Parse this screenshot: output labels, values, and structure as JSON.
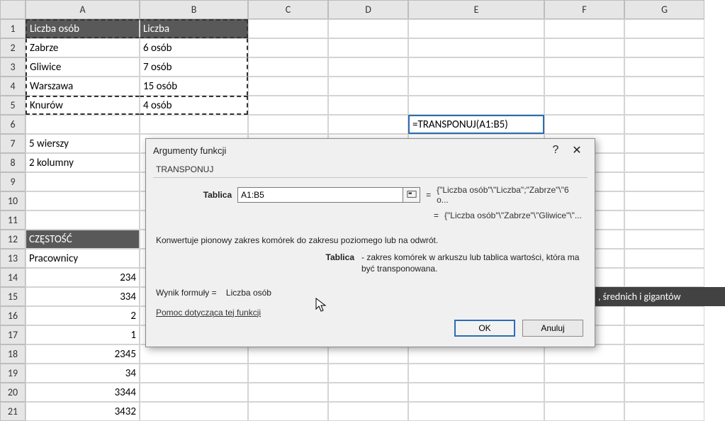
{
  "columns": [
    "A",
    "B",
    "C",
    "D",
    "E",
    "F",
    "G"
  ],
  "rows": [
    "1",
    "2",
    "3",
    "4",
    "5",
    "6",
    "7",
    "8",
    "9",
    "10",
    "11",
    "12",
    "13",
    "14",
    "15",
    "16",
    "17",
    "18",
    "19",
    "20",
    "21"
  ],
  "grid": {
    "A1": "Liczba osób",
    "B1": "Liczba",
    "A2": "Zabrze",
    "B2": "6 osób",
    "A3": "Gliwice",
    "B3": "7 osób",
    "A4": "Warszawa",
    "B4": "15 osób",
    "A5": "Knurów",
    "B5": "4 osób",
    "E6": "=TRANSPONUJ(A1:B5)",
    "A7": "5 wierszy",
    "A8": "2 kolumny",
    "A12": "CZĘSTOŚĆ",
    "A13": "Pracownicy",
    "A14": "234",
    "A15": "334",
    "A16": "2",
    "A17": "1",
    "A18": "2345",
    "A19": "34",
    "A20": "3344",
    "A21": "3432"
  },
  "right_strip": ", średnich i gigantów",
  "dialog": {
    "title": "Argumenty funkcji",
    "help_btn": "?",
    "close_btn": "✕",
    "function": "TRANSPONUJ",
    "param_label": "Tablica",
    "param_value": "A1:B5",
    "preview1": "{\"Liczba osób\"\\\"Liczba\";\"Zabrze\"\\\"6 o...",
    "preview2": "{\"Liczba osób\"\\\"Zabrze\"\\\"Gliwice\"\\\"...",
    "description": "Konwertuje pionowy zakres komórek do zakresu poziomego lub na odwrót.",
    "param_name": "Tablica",
    "param_desc": "- zakres komórek w arkuszu lub tablica wartości, która ma być transponowana.",
    "result_label": "Wynik formuły =",
    "result_value": "Liczba osób",
    "help_link": "Pomoc dotycząca tej funkcji",
    "ok": "OK",
    "cancel": "Anuluj"
  }
}
